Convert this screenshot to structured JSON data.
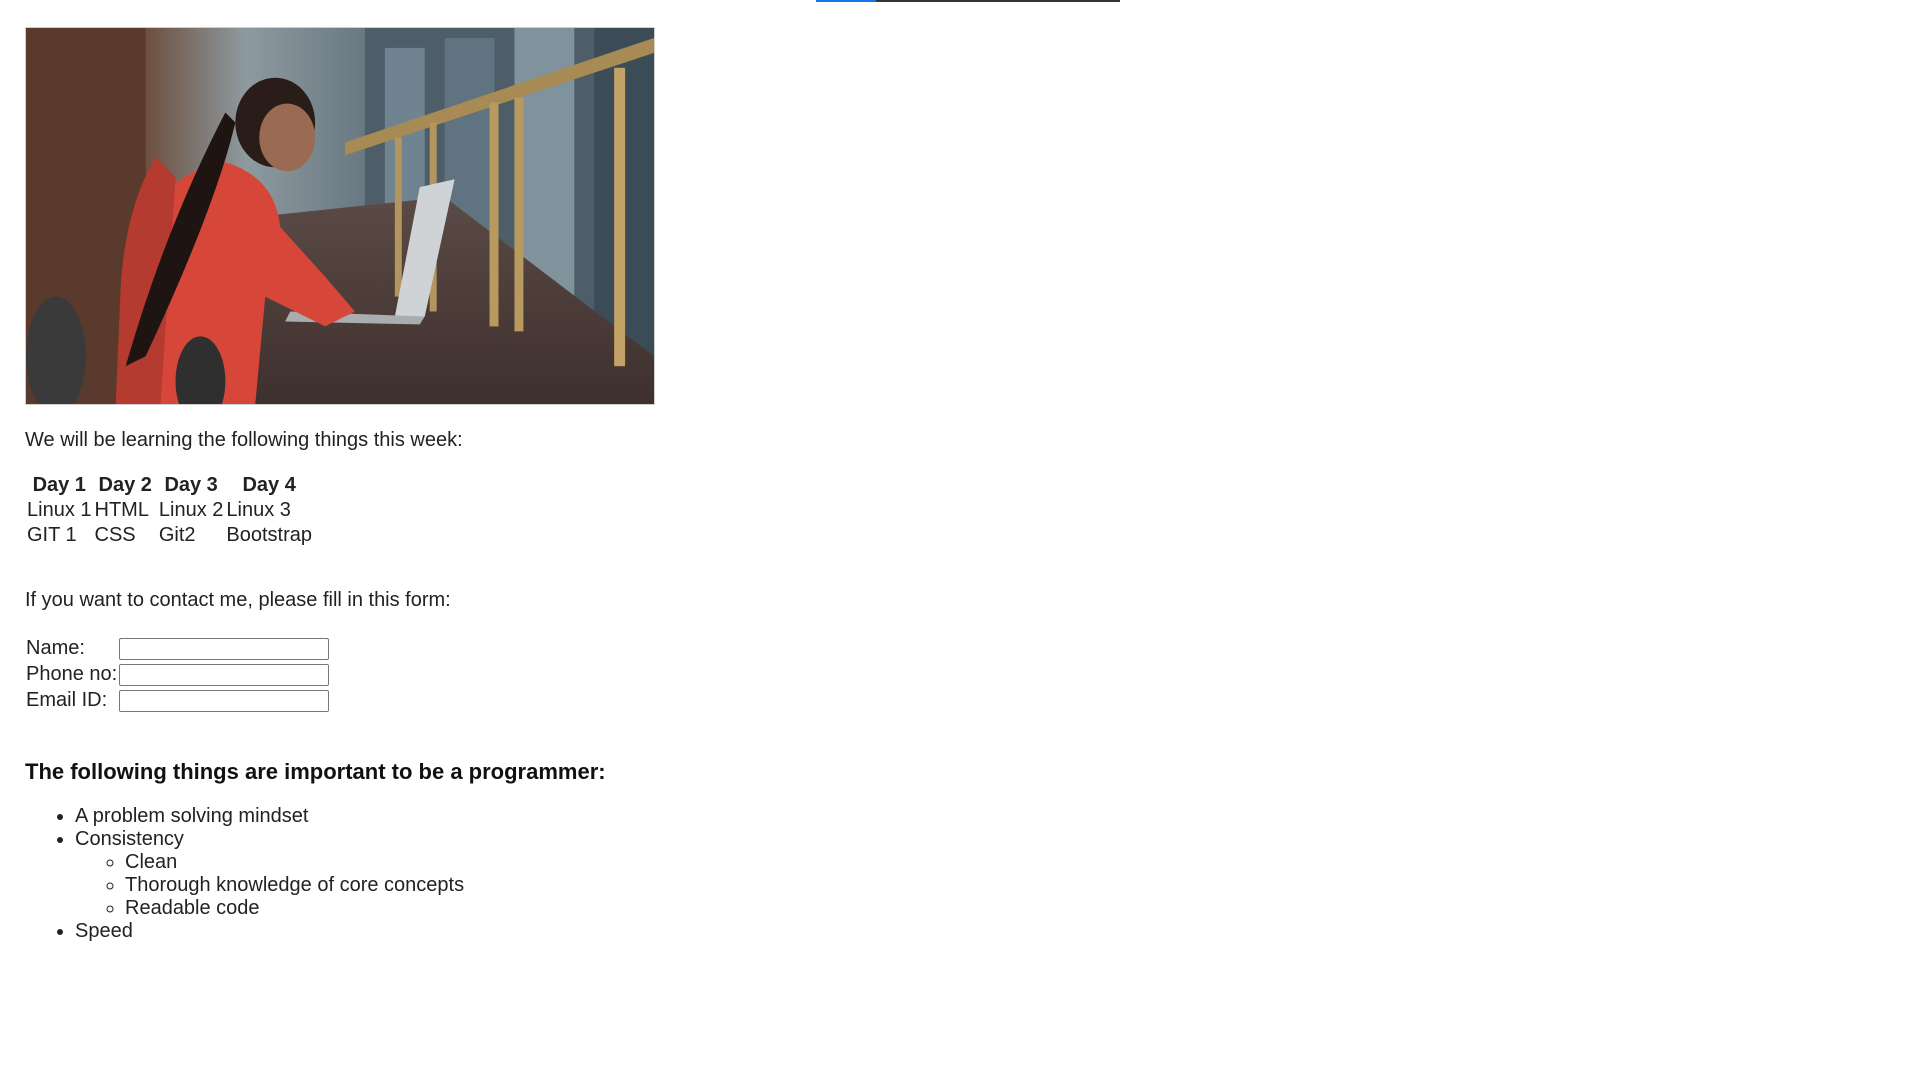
{
  "intro_text": "We will be learning the following things this week:",
  "schedule": {
    "headers": [
      "Day 1",
      "Day 2",
      "Day 3",
      "Day 4"
    ],
    "rows": [
      [
        "Linux 1",
        "HTML",
        "Linux 2",
        "Linux 3"
      ],
      [
        "GIT 1",
        "CSS",
        "Git2",
        "Bootstrap"
      ]
    ]
  },
  "contact_intro": "If you want to contact me, please fill in this form:",
  "form": {
    "name_label": "Name:",
    "phone_label": "Phone no:",
    "email_label": "Email ID:",
    "name_value": "",
    "phone_value": "",
    "email_value": ""
  },
  "programmer": {
    "heading": "The following things are important to be a programmer:",
    "items": [
      "A problem solving mindset",
      "Consistency",
      "Speed"
    ],
    "sub_items": [
      "Clean",
      "Thorough knowledge of core concepts",
      "Readable code"
    ]
  },
  "colors": {
    "accent": "#1a73e8",
    "text": "#222222"
  },
  "image": {
    "icon": "photo-woman-laptop"
  }
}
